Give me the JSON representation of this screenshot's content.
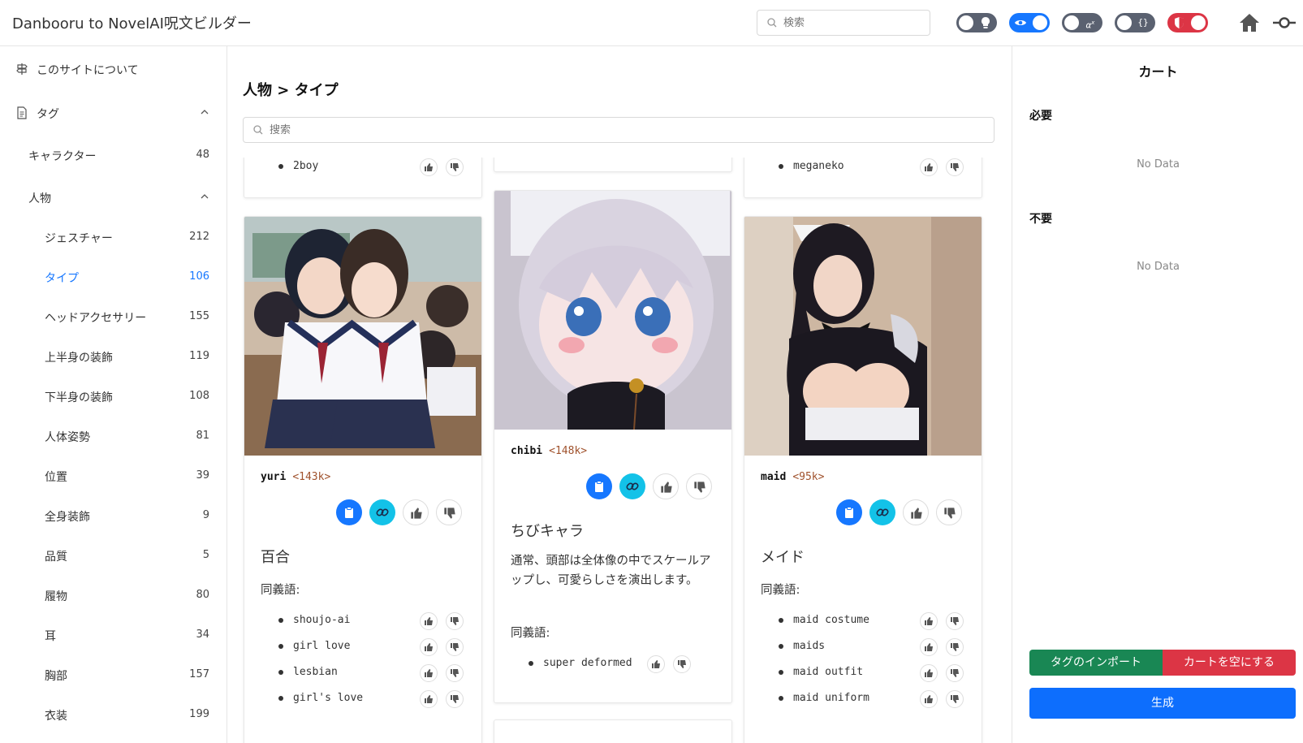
{
  "header": {
    "title": "Danbooru to NovelAI呪文ビルダー",
    "search_placeholder": "検索",
    "toggles": [
      {
        "name": "theme-toggle",
        "icon": "lightbulb-icon",
        "on": false,
        "color": "#5a6170"
      },
      {
        "name": "preview-toggle",
        "icon": "eye-icon",
        "on": true,
        "color": "#1677ff"
      },
      {
        "name": "formula-toggle",
        "icon": "alpha-x-icon",
        "on": false,
        "color": "#5a6170"
      },
      {
        "name": "braces-toggle",
        "icon": "braces-icon",
        "on": false,
        "color": "#5a6170"
      },
      {
        "name": "nsfw-toggle",
        "icon": "shield-icon",
        "on": true,
        "color": "#dc3545"
      }
    ]
  },
  "sidebar": {
    "about": "このサイトについて",
    "tags_header": "タグ",
    "character": {
      "label": "キャラクター",
      "count": "48"
    },
    "person_header": "人物",
    "items": [
      {
        "label": "ジェスチャー",
        "count": "212",
        "active": false
      },
      {
        "label": "タイプ",
        "count": "106",
        "active": true
      },
      {
        "label": "ヘッドアクセサリー",
        "count": "155",
        "active": false
      },
      {
        "label": "上半身の装飾",
        "count": "119",
        "active": false
      },
      {
        "label": "下半身の装飾",
        "count": "108",
        "active": false
      },
      {
        "label": "人体姿勢",
        "count": "81",
        "active": false
      },
      {
        "label": "位置",
        "count": "39",
        "active": false
      },
      {
        "label": "全身装飾",
        "count": "9",
        "active": false
      },
      {
        "label": "品質",
        "count": "5",
        "active": false
      },
      {
        "label": "履物",
        "count": "80",
        "active": false
      },
      {
        "label": "耳",
        "count": "34",
        "active": false
      },
      {
        "label": "胸部",
        "count": "157",
        "active": false
      },
      {
        "label": "衣装",
        "count": "199",
        "active": false
      }
    ]
  },
  "main": {
    "breadcrumb": "人物 > タイプ",
    "search_placeholder": "搜索",
    "top_partial": {
      "left_item": "2boy",
      "right_item": "meganeko"
    },
    "cards": [
      {
        "tag": "yuri",
        "count": "<143k>",
        "title": "百合",
        "description": "",
        "synonyms_label": "同義語:",
        "synonyms": [
          "shoujo-ai",
          "girl love",
          "lesbian",
          "girl's love"
        ]
      },
      {
        "tag": "chibi",
        "count": "<148k>",
        "title": "ちびキャラ",
        "description": "通常、頭部は全体像の中でスケールアップし、可愛らしさを演出します。",
        "synonyms_label": "同義語:",
        "synonyms": [
          "super deformed"
        ]
      },
      {
        "tag": "maid",
        "count": "<95k>",
        "title": "メイド",
        "description": "",
        "synonyms_label": "同義語:",
        "synonyms": [
          "maid costume",
          "maids",
          "maid outfit",
          "maid uniform"
        ]
      }
    ]
  },
  "cart": {
    "title": "カート",
    "required_label": "必要",
    "unneeded_label": "不要",
    "no_data": "No Data",
    "import_button": "タグのインポート",
    "clear_button": "カートを空にする",
    "generate_button": "生成",
    "colors": {
      "import": "#198754",
      "clear": "#dc3545",
      "generate": "#0d6efd"
    }
  }
}
